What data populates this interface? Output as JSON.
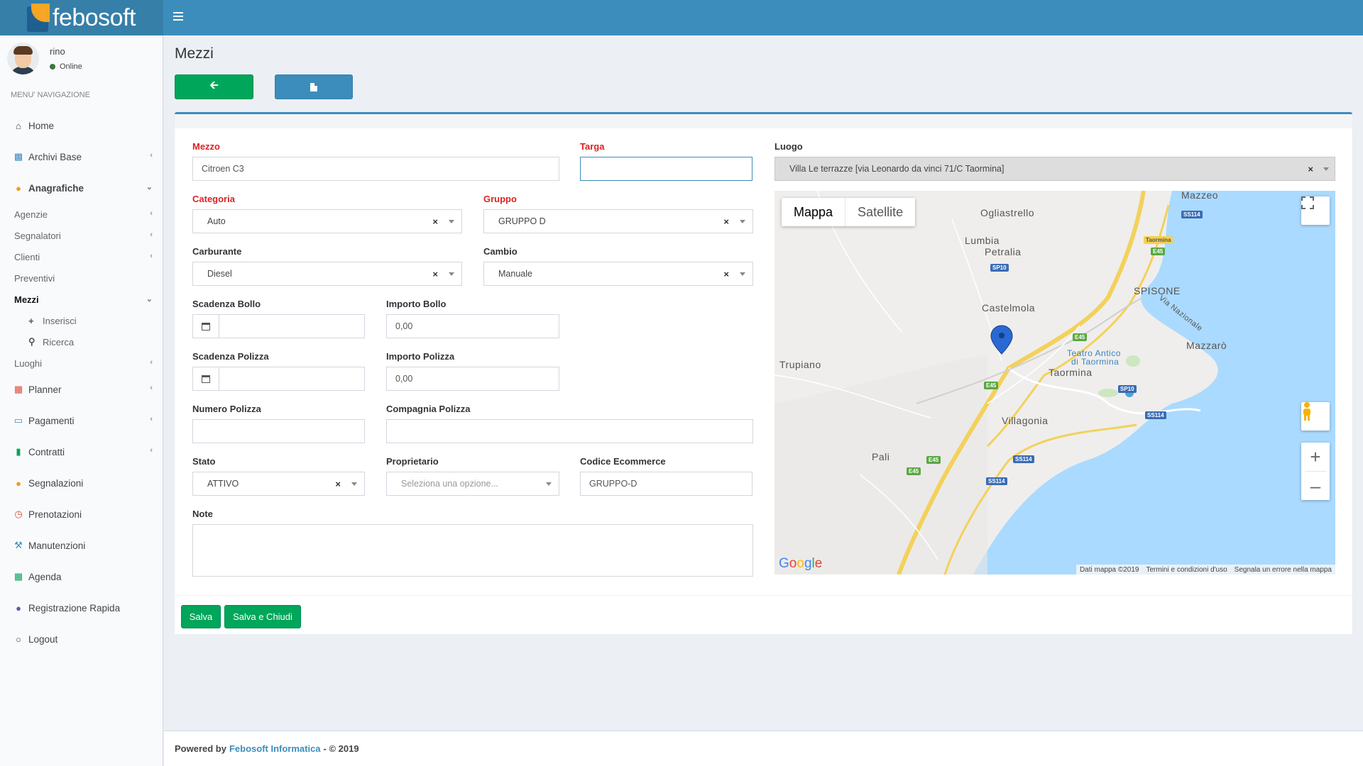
{
  "header": {
    "brand": "febosoft"
  },
  "user": {
    "name": "rino",
    "status": "Online"
  },
  "nav": {
    "header": "MENU' NAVIGAZIONE",
    "items": {
      "home": "Home",
      "archivi": "Archivi Base",
      "anagrafiche": "Anagrafiche",
      "agenzie": "Agenzie",
      "segnalatori": "Segnalatori",
      "clienti": "Clienti",
      "preventivi": "Preventivi",
      "mezzi": "Mezzi",
      "inserisci": "Inserisci",
      "ricerca": "Ricerca",
      "luoghi": "Luoghi",
      "planner": "Planner",
      "pagamenti": "Pagamenti",
      "contratti": "Contratti",
      "segnalazioni": "Segnalazioni",
      "prenotazioni": "Prenotazioni",
      "manutenzioni": "Manutenzioni",
      "agenda": "Agenda",
      "registrazione": "Registrazione Rapida",
      "logout": "Logout"
    }
  },
  "page": {
    "title": "Mezzi"
  },
  "form": {
    "mezzo": {
      "label": "Mezzo",
      "value": "Citroen C3"
    },
    "targa": {
      "label": "Targa",
      "value": ""
    },
    "categoria": {
      "label": "Categoria",
      "value": "Auto"
    },
    "gruppo": {
      "label": "Gruppo",
      "value": "GRUPPO D"
    },
    "carburante": {
      "label": "Carburante",
      "value": "Diesel"
    },
    "cambio": {
      "label": "Cambio",
      "value": "Manuale"
    },
    "scadenza_bollo": {
      "label": "Scadenza Bollo"
    },
    "importo_bollo": {
      "label": "Importo Bollo",
      "value": "0,00"
    },
    "scadenza_polizza": {
      "label": "Scadenza Polizza"
    },
    "importo_polizza": {
      "label": "Importo Polizza",
      "value": "0,00"
    },
    "numero_polizza": {
      "label": "Numero Polizza",
      "value": ""
    },
    "compagnia_polizza": {
      "label": "Compagnia Polizza",
      "value": ""
    },
    "stato": {
      "label": "Stato",
      "value": "ATTIVO"
    },
    "proprietario": {
      "label": "Proprietario",
      "placeholder": "Seleziona una opzione..."
    },
    "codice_ecommerce": {
      "label": "Codice Ecommerce",
      "value": "GRUPPO-D"
    },
    "note": {
      "label": "Note"
    },
    "luogo": {
      "label": "Luogo",
      "value": "Villa Le terrazze [via Leonardo da vinci 71/C Taormina]"
    }
  },
  "map": {
    "type_map": "Mappa",
    "type_satellite": "Satellite",
    "places": {
      "mazzeo": "Mazzeo",
      "ogliastrello": "Ogliastrello",
      "lumbia": "Lumbia",
      "petralia": "Petralia",
      "spisone": "SPISONE",
      "castelmola": "Castelmola",
      "mazzaro": "Mazzarò",
      "trupiano": "Trupiano",
      "teatro": "Teatro Antico",
      "teatro2": "di Taormina",
      "taormina": "Taormina",
      "villagonia": "Villagonia",
      "pali": "Pali",
      "via_nazionale": "Via Nazionale",
      "taormina_small": "Taormina"
    },
    "roads": {
      "ss114": "SS114",
      "e45": "E45",
      "sp10": "SP10"
    },
    "google": "Google",
    "attribution": [
      "Dati mappa ©2019",
      "Termini e condizioni d'uso",
      "Segnala un errore nella mappa"
    ]
  },
  "buttons": {
    "salva": "Salva",
    "salva_chiudi": "Salva e Chiudi"
  },
  "footer": {
    "powered": "Powered by",
    "company": "Febosoft Informatica",
    "copyright": "- © 2019"
  },
  "colors": {
    "primary": "#3c8dbc",
    "success": "#00a65a",
    "required": "#dd2222"
  }
}
